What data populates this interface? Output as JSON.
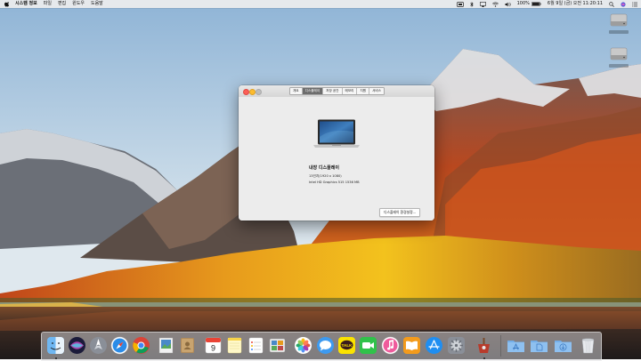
{
  "menubar": {
    "app_name": "시스템 정보",
    "items": [
      "파일",
      "편집",
      "윈도우",
      "도움말"
    ],
    "battery": "100%",
    "clock": "6월 9일 (금) 오전 11:20:11"
  },
  "desktop_disks": [
    {
      "icon": "hard-disk-icon"
    },
    {
      "icon": "hard-disk-icon"
    }
  ],
  "about_window": {
    "tabs": [
      {
        "label": "개요",
        "active": false
      },
      {
        "label": "디스플레이",
        "active": true
      },
      {
        "label": "저장 공간",
        "active": false
      },
      {
        "label": "메모리",
        "active": false
      },
      {
        "label": "지원",
        "active": false
      },
      {
        "label": "서비스",
        "active": false
      }
    ],
    "display_name": "내장 디스플레이",
    "resolution": "13인치(1920 x 1080)",
    "graphics": "Intel HD Graphics 515 1536 MB",
    "prefs_button": "디스플레이 환경설정..."
  },
  "dock": {
    "apps": [
      {
        "name": "finder",
        "icon": "finder-icon",
        "running": true
      },
      {
        "name": "siri",
        "icon": "siri-icon",
        "running": false
      },
      {
        "name": "launchpad",
        "icon": "launchpad-icon",
        "running": false
      },
      {
        "name": "safari",
        "icon": "safari-icon",
        "running": false
      },
      {
        "name": "chrome",
        "icon": "chrome-icon",
        "running": false
      },
      {
        "name": "preview",
        "icon": "photo-viewer-icon",
        "running": false
      },
      {
        "name": "contacts",
        "icon": "contacts-icon",
        "running": false
      },
      {
        "name": "calendar",
        "icon": "calendar-icon",
        "running": false,
        "text": "9"
      },
      {
        "name": "notes",
        "icon": "notes-icon",
        "running": false
      },
      {
        "name": "reminders",
        "icon": "reminders-icon",
        "running": false
      },
      {
        "name": "photo-booth",
        "icon": "photo-gallery-icon",
        "running": false
      },
      {
        "name": "photos",
        "icon": "photos-icon",
        "running": false
      },
      {
        "name": "messages",
        "icon": "messages-icon",
        "running": false
      },
      {
        "name": "kakaotalk",
        "icon": "kakaotalk-icon",
        "running": false,
        "text": "TALK"
      },
      {
        "name": "facetime",
        "icon": "facetime-icon",
        "running": false
      },
      {
        "name": "itunes",
        "icon": "music-icon",
        "running": false
      },
      {
        "name": "ibooks",
        "icon": "books-icon",
        "running": false
      },
      {
        "name": "app-store",
        "icon": "app-store-icon",
        "running": false
      },
      {
        "name": "system-preferences",
        "icon": "gear-icon",
        "running": false
      },
      {
        "name": "system-information",
        "icon": "system-information-icon",
        "running": true
      }
    ],
    "folders": [
      {
        "name": "applications",
        "icon": "applications-folder-icon"
      },
      {
        "name": "documents",
        "icon": "documents-folder-icon"
      },
      {
        "name": "downloads",
        "icon": "downloads-folder-icon"
      },
      {
        "name": "trash",
        "icon": "trash-icon"
      }
    ]
  }
}
